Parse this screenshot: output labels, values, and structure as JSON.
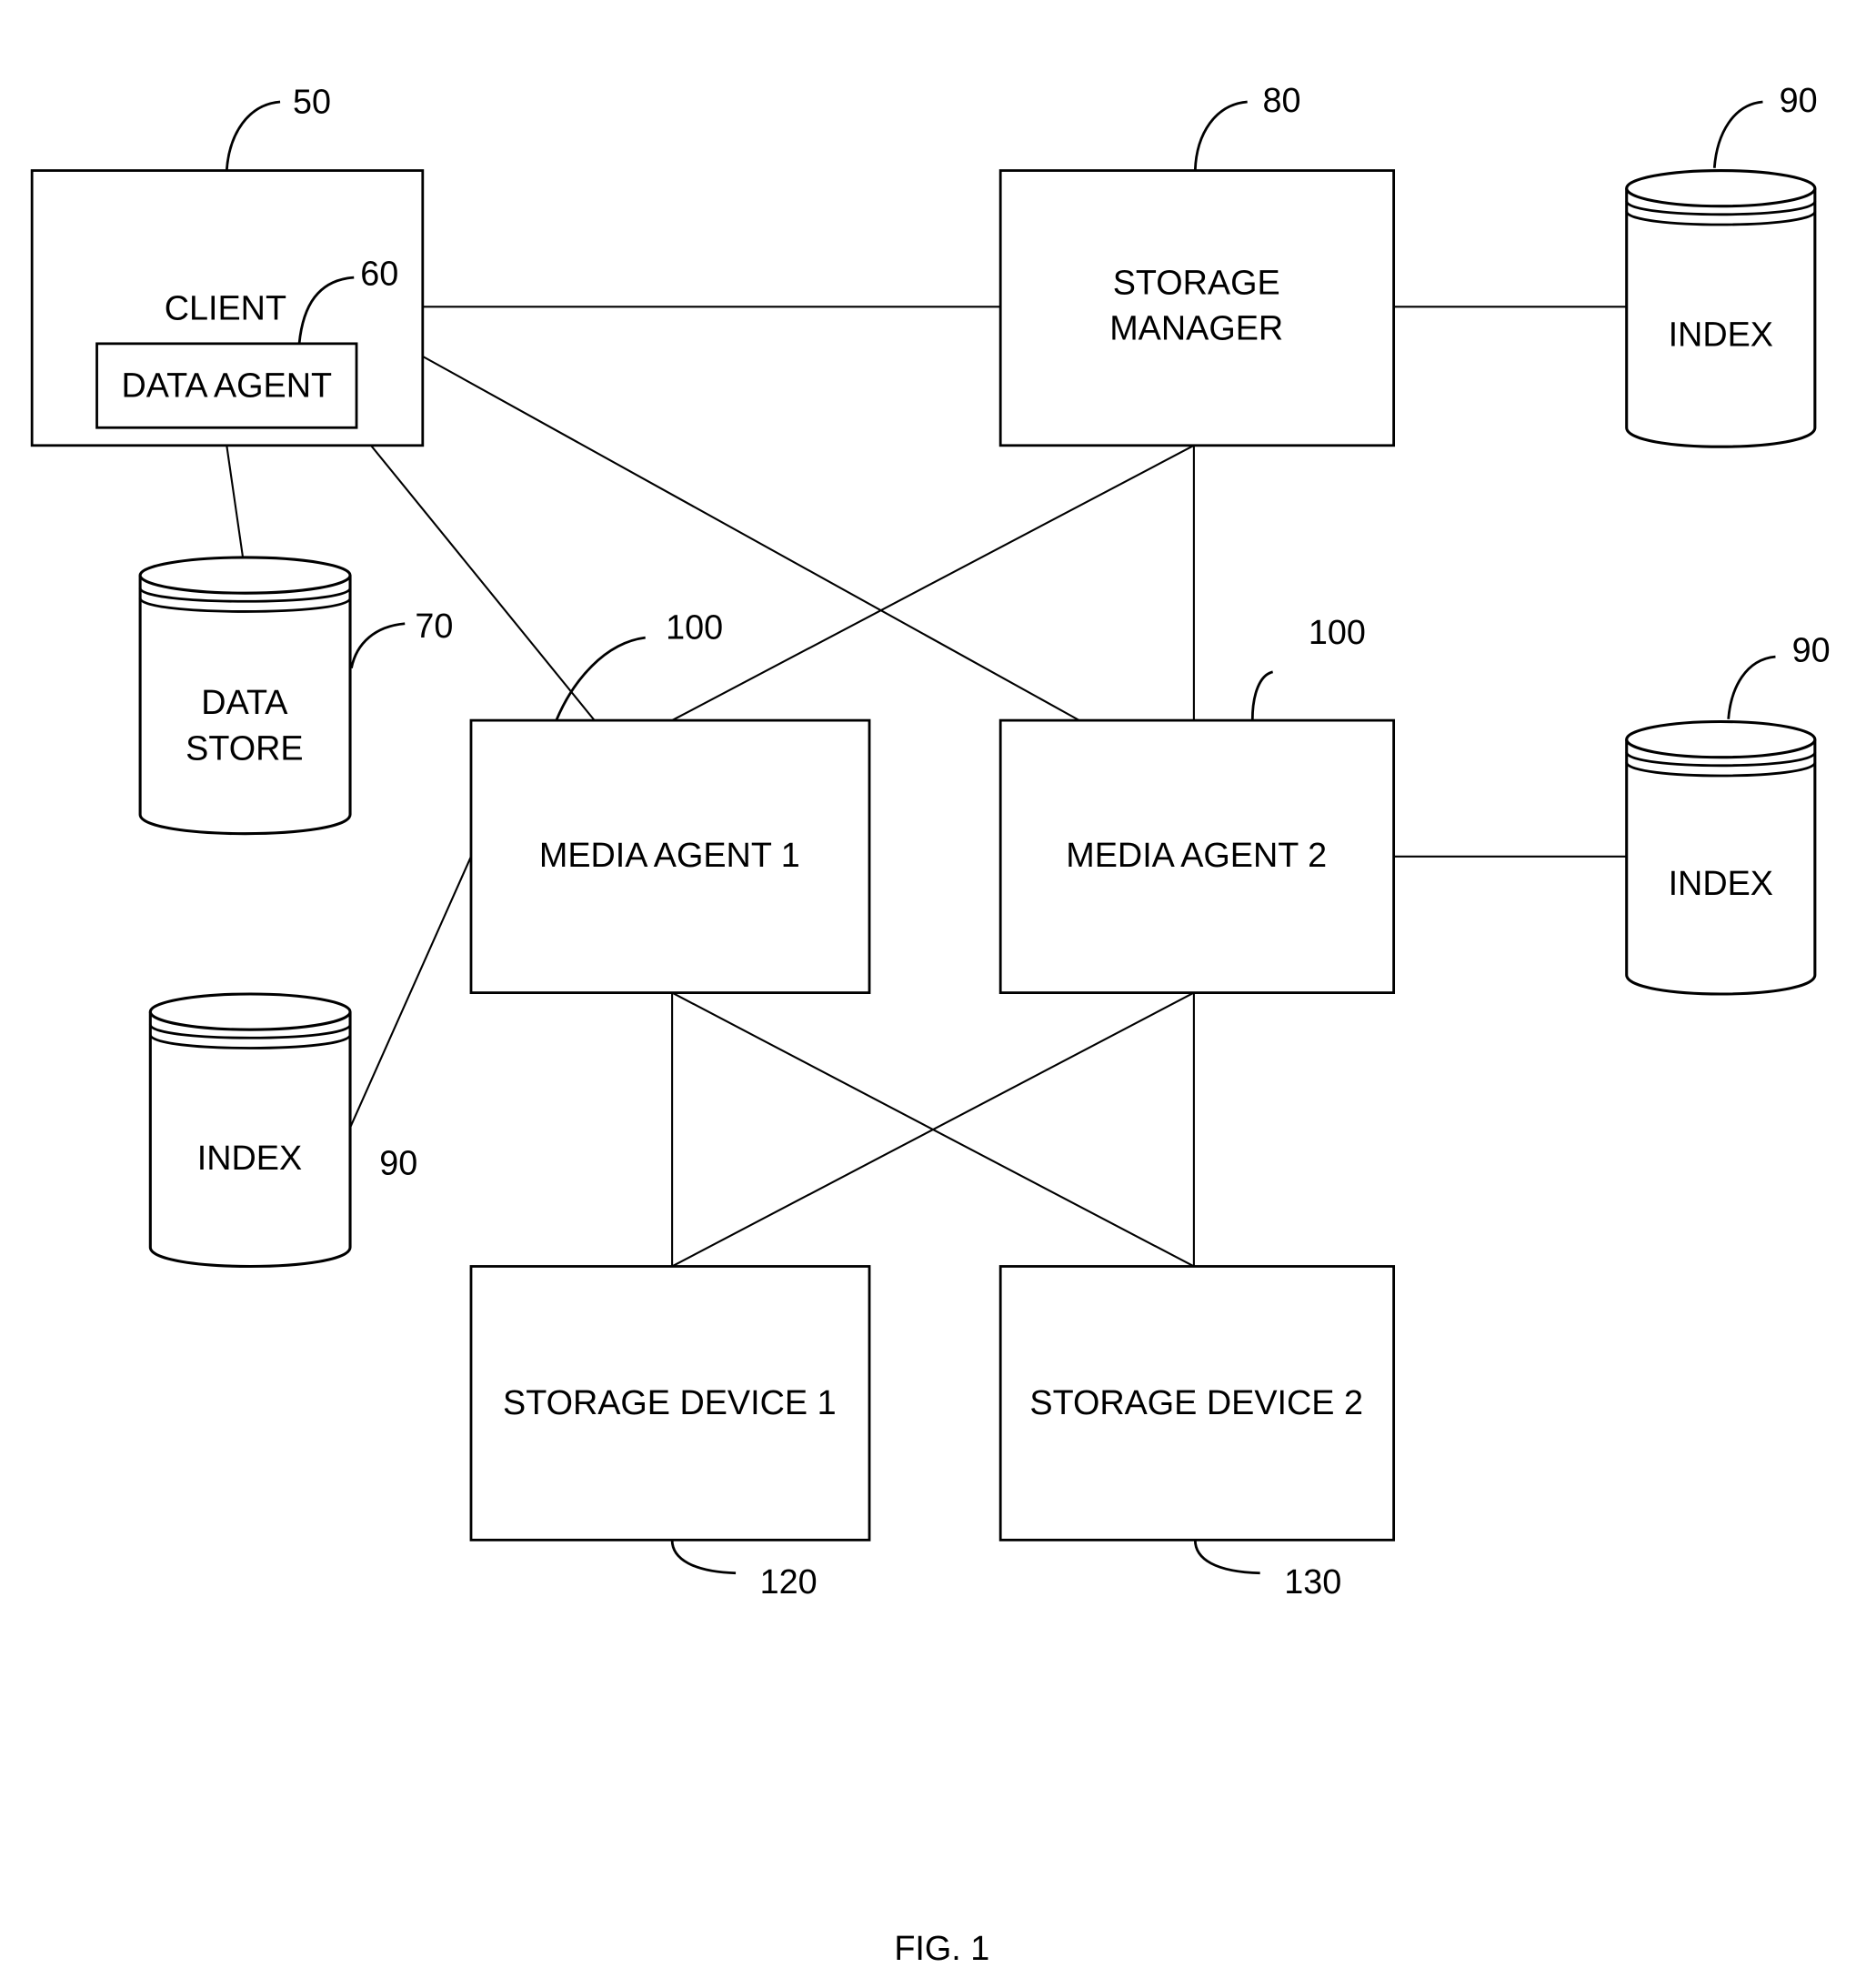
{
  "figure": {
    "caption": "FIG. 1",
    "nodes": {
      "client": {
        "label": "CLIENT",
        "ref": "50"
      },
      "data_agent": {
        "label": "DATA AGENT",
        "ref": "60"
      },
      "data_store": {
        "label_line1": "DATA",
        "label_line2": "STORE",
        "ref": "70"
      },
      "storage_manager": {
        "label_line1": "STORAGE",
        "label_line2": "MANAGER",
        "ref": "80"
      },
      "index_top": {
        "label": "INDEX",
        "ref": "90"
      },
      "index_mid": {
        "label": "INDEX",
        "ref": "90"
      },
      "index_left": {
        "label": "INDEX",
        "ref": "90"
      },
      "media_agent_1": {
        "label": "MEDIA AGENT 1",
        "ref": "100"
      },
      "media_agent_2": {
        "label": "MEDIA AGENT 2",
        "ref": "100"
      },
      "storage_device_1": {
        "label": "STORAGE DEVICE 1",
        "ref": "120"
      },
      "storage_device_2": {
        "label": "STORAGE DEVICE 2",
        "ref": "130"
      }
    },
    "connections": [
      [
        "client",
        "storage_manager"
      ],
      [
        "client",
        "media_agent_2"
      ],
      [
        "data_agent",
        "media_agent_1"
      ],
      [
        "client",
        "data_store"
      ],
      [
        "storage_manager",
        "index_top"
      ],
      [
        "storage_manager",
        "media_agent_1"
      ],
      [
        "storage_manager",
        "media_agent_2"
      ],
      [
        "media_agent_2",
        "index_mid"
      ],
      [
        "media_agent_1",
        "index_left"
      ],
      [
        "media_agent_1",
        "storage_device_1"
      ],
      [
        "media_agent_1",
        "storage_device_2"
      ],
      [
        "media_agent_2",
        "storage_device_1"
      ],
      [
        "media_agent_2",
        "storage_device_2"
      ]
    ]
  }
}
